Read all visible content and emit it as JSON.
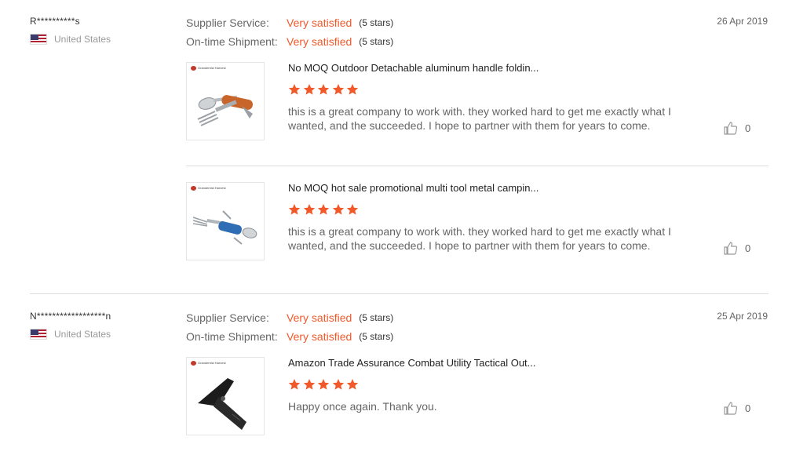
{
  "labels": {
    "supplier_service": "Supplier Service:",
    "ontime_shipment": "On-time Shipment:",
    "logo_text": "Grandemist Harvest"
  },
  "reviews": [
    {
      "buyer": "R**********s",
      "country": "United States",
      "date": "26 Apr 2019",
      "supplier_service": {
        "value": "Very satisfied",
        "stars_text": "(5 stars)"
      },
      "ontime_shipment": {
        "value": "Very satisfied",
        "stars_text": "(5 stars)"
      },
      "items": [
        {
          "product": "No MOQ Outdoor Detachable aluminum handle foldin...",
          "rating": 5,
          "comment": "this is a great company to work with.  they worked hard to get me exactly what I wanted,  and the succeeded.  I hope to partner with them for years to come.",
          "likes": "0"
        },
        {
          "product": "No MOQ hot sale promotional multi tool metal campin...",
          "rating": 5,
          "comment": "this is a great company to work with.  they worked hard to get me exactly what I wanted,  and the succeeded.  I hope to partner with them for years to come.",
          "likes": "0"
        }
      ]
    },
    {
      "buyer": "N******************n",
      "country": "United States",
      "date": "25 Apr 2019",
      "supplier_service": {
        "value": "Very satisfied",
        "stars_text": "(5 stars)"
      },
      "ontime_shipment": {
        "value": "Very satisfied",
        "stars_text": "(5 stars)"
      },
      "items": [
        {
          "product": "Amazon Trade Assurance Combat Utility Tactical Out...",
          "rating": 5,
          "comment": "Happy once again. Thank you.",
          "likes": "0"
        }
      ]
    }
  ],
  "colors": {
    "accent": "#f1592a",
    "muted_text": "#666666",
    "divider": "#dddddd"
  }
}
